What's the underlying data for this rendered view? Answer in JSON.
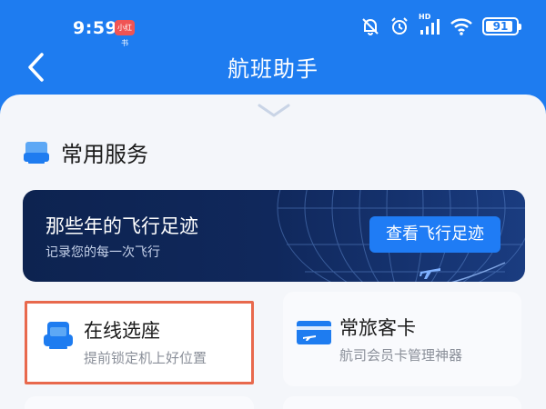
{
  "status_bar": {
    "time": "9:59",
    "app_badge": "小红书",
    "network": "HD",
    "battery_level": 91,
    "battery_text": "91"
  },
  "nav": {
    "title": "航班助手"
  },
  "section": {
    "title": "常用服务"
  },
  "banner": {
    "title": "那些年的飞行足迹",
    "subtitle": "记录您的每一次飞行",
    "button_label": "查看飞行足迹"
  },
  "cards": [
    {
      "title": "在线选座",
      "subtitle": "提前锁定机上好位置"
    },
    {
      "title": "常旅客卡",
      "subtitle": "航司会员卡管理神器"
    }
  ],
  "colors": {
    "brand_blue": "#1e7cf0",
    "highlight_border": "#e8694d",
    "banner_dark": "#10285c"
  }
}
